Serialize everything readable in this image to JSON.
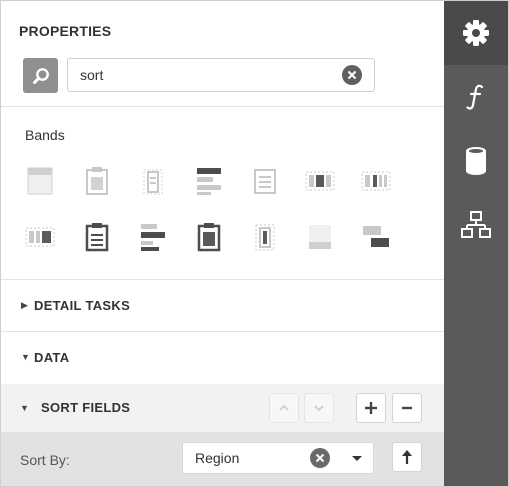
{
  "panel": {
    "title": "PROPERTIES",
    "search": {
      "value": "sort",
      "placeholder": ""
    }
  },
  "bands": {
    "label": "Bands",
    "count": 14
  },
  "sections": {
    "detail_tasks": "DETAIL TASKS",
    "data": "DATA",
    "sort_fields": "SORT FIELDS"
  },
  "sort_by": {
    "label": "Sort By:",
    "value": "Region"
  },
  "rail": {
    "items": [
      "gear-icon",
      "function-icon",
      "database-icon",
      "hierarchy-icon"
    ],
    "active": "gear-icon"
  },
  "colors": {
    "rail": "#5a5a5a",
    "rail_active": "#4a4a4a",
    "icon_dark": "#4d4d4d",
    "icon_light": "#c8c8c8",
    "sort_fields_bg": "#f2f2f2",
    "sort_by_bg": "#e2e2e2"
  }
}
